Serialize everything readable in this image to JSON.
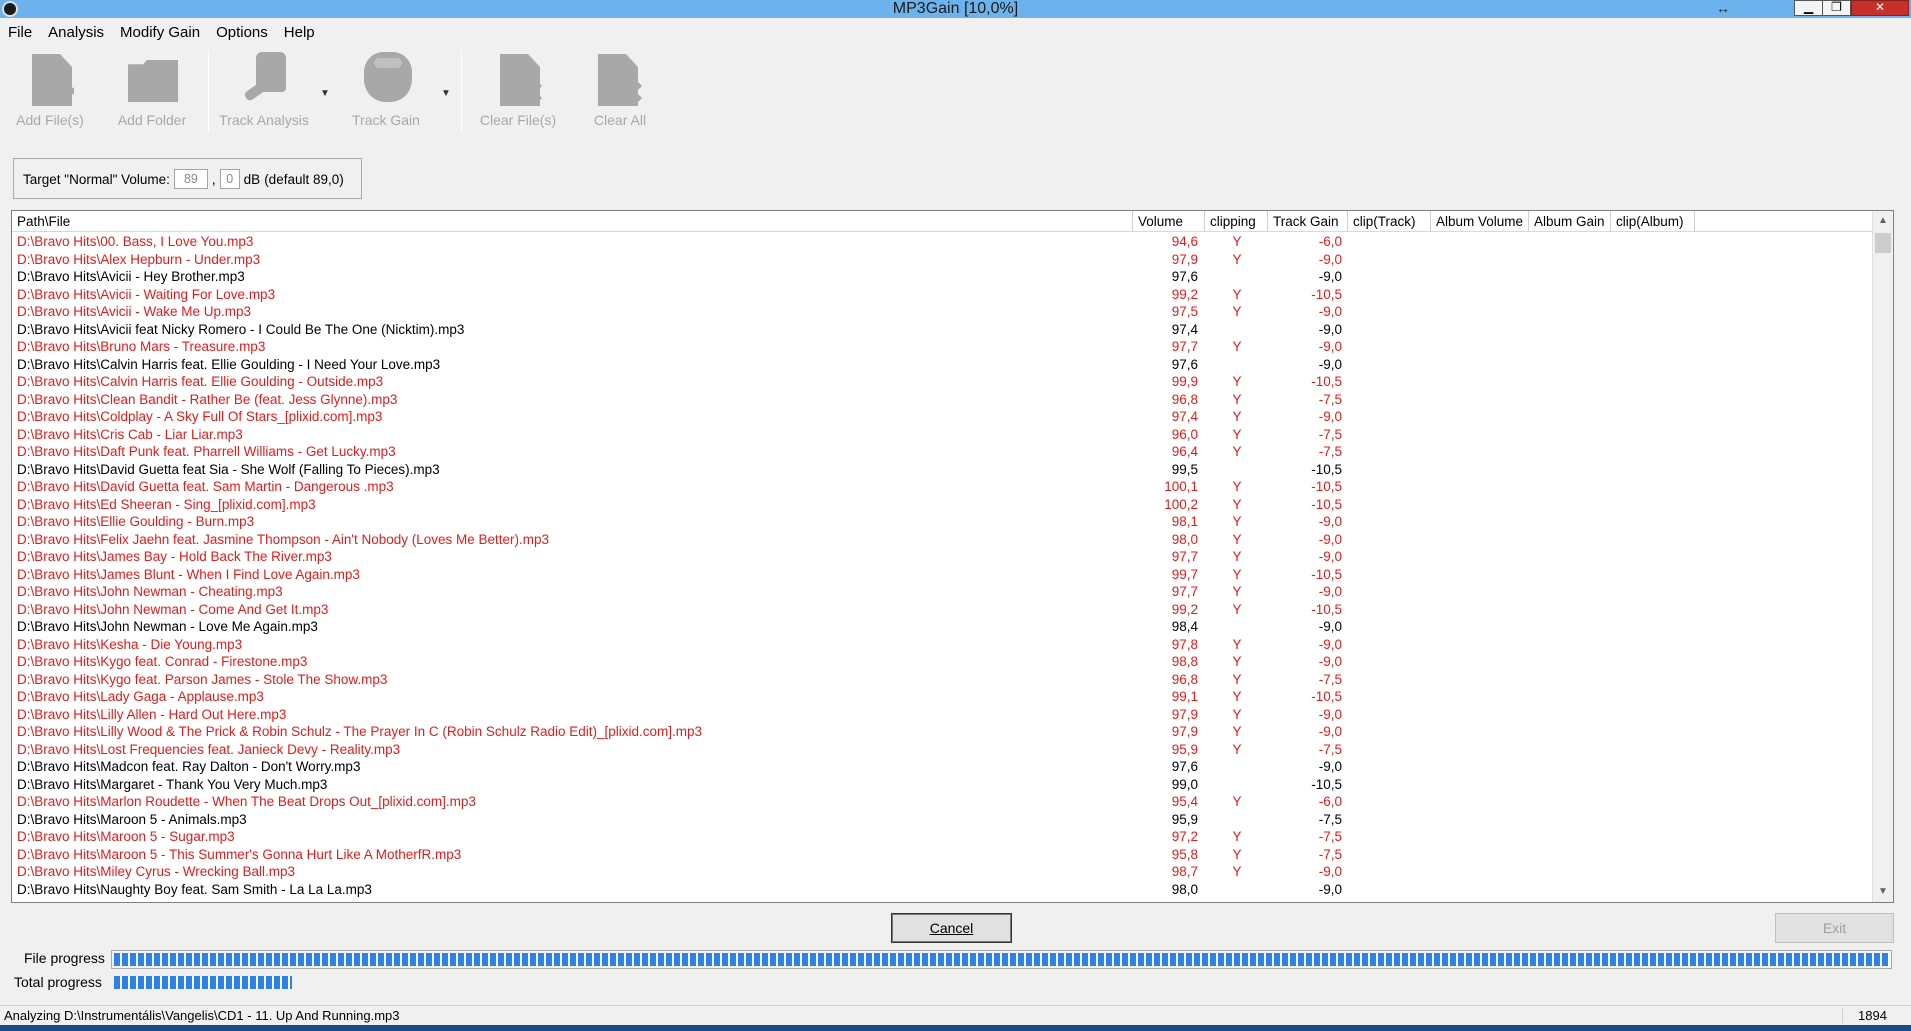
{
  "window": {
    "title": "MP3Gain [10,0%]",
    "resize_icon": "↔",
    "min_icon": "▁",
    "max_icon": "❐",
    "close_icon": "✕"
  },
  "menu": [
    "File",
    "Analysis",
    "Modify Gain",
    "Options",
    "Help"
  ],
  "toolbar": {
    "add_files": "Add File(s)",
    "add_folder": "Add Folder",
    "track_analysis": "Track Analysis",
    "track_gain": "Track Gain",
    "clear_files": "Clear File(s)",
    "clear_all": "Clear All",
    "dropdown_glyph": "▼"
  },
  "target": {
    "label": "Target \"Normal\" Volume:",
    "int_value": "89",
    "comma": ",",
    "dec_value": "0",
    "unit": "dB",
    "default_text": "(default 89,0)"
  },
  "columns": [
    "Path\\File",
    "Volume",
    "clipping",
    "Track Gain",
    "clip(Track)",
    "Album Volume",
    "Album Gain",
    "clip(Album)"
  ],
  "files": [
    {
      "path": "D:\\Bravo Hits\\00. Bass, I Love You.mp3",
      "volume": "94,6",
      "clipping": "Y",
      "gain": "-6,0",
      "red": true
    },
    {
      "path": "D:\\Bravo Hits\\Alex Hepburn - Under.mp3",
      "volume": "97,9",
      "clipping": "Y",
      "gain": "-9,0",
      "red": true
    },
    {
      "path": "D:\\Bravo Hits\\Avicii - Hey Brother.mp3",
      "volume": "97,6",
      "clipping": "",
      "gain": "-9,0",
      "red": false
    },
    {
      "path": "D:\\Bravo Hits\\Avicii - Waiting For Love.mp3",
      "volume": "99,2",
      "clipping": "Y",
      "gain": "-10,5",
      "red": true
    },
    {
      "path": "D:\\Bravo Hits\\Avicii - Wake Me Up.mp3",
      "volume": "97,5",
      "clipping": "Y",
      "gain": "-9,0",
      "red": true
    },
    {
      "path": "D:\\Bravo Hits\\Avicii feat Nicky Romero - I Could Be The One (Nicktim).mp3",
      "volume": "97,4",
      "clipping": "",
      "gain": "-9,0",
      "red": false
    },
    {
      "path": "D:\\Bravo Hits\\Bruno Mars - Treasure.mp3",
      "volume": "97,7",
      "clipping": "Y",
      "gain": "-9,0",
      "red": true
    },
    {
      "path": "D:\\Bravo Hits\\Calvin Harris feat. Ellie Goulding - I Need Your Love.mp3",
      "volume": "97,6",
      "clipping": "",
      "gain": "-9,0",
      "red": false
    },
    {
      "path": "D:\\Bravo Hits\\Calvin Harris feat. Ellie Goulding - Outside.mp3",
      "volume": "99,9",
      "clipping": "Y",
      "gain": "-10,5",
      "red": true
    },
    {
      "path": "D:\\Bravo Hits\\Clean Bandit - Rather Be (feat. Jess Glynne).mp3",
      "volume": "96,8",
      "clipping": "Y",
      "gain": "-7,5",
      "red": true
    },
    {
      "path": "D:\\Bravo Hits\\Coldplay - A Sky Full Of Stars_[plixid.com].mp3",
      "volume": "97,4",
      "clipping": "Y",
      "gain": "-9,0",
      "red": true
    },
    {
      "path": "D:\\Bravo Hits\\Cris Cab - Liar Liar.mp3",
      "volume": "96,0",
      "clipping": "Y",
      "gain": "-7,5",
      "red": true
    },
    {
      "path": "D:\\Bravo Hits\\Daft Punk feat. Pharrell Williams - Get Lucky.mp3",
      "volume": "96,4",
      "clipping": "Y",
      "gain": "-7,5",
      "red": true
    },
    {
      "path": "D:\\Bravo Hits\\David Guetta feat Sia - She Wolf (Falling To Pieces).mp3",
      "volume": "99,5",
      "clipping": "",
      "gain": "-10,5",
      "red": false
    },
    {
      "path": "D:\\Bravo Hits\\David Guetta feat. Sam Martin - Dangerous .mp3",
      "volume": "100,1",
      "clipping": "Y",
      "gain": "-10,5",
      "red": true
    },
    {
      "path": "D:\\Bravo Hits\\Ed Sheeran - Sing_[plixid.com].mp3",
      "volume": "100,2",
      "clipping": "Y",
      "gain": "-10,5",
      "red": true
    },
    {
      "path": "D:\\Bravo Hits\\Ellie Goulding - Burn.mp3",
      "volume": "98,1",
      "clipping": "Y",
      "gain": "-9,0",
      "red": true
    },
    {
      "path": "D:\\Bravo Hits\\Felix Jaehn feat. Jasmine Thompson - Ain't Nobody (Loves Me Better).mp3",
      "volume": "98,0",
      "clipping": "Y",
      "gain": "-9,0",
      "red": true
    },
    {
      "path": "D:\\Bravo Hits\\James Bay - Hold Back The River.mp3",
      "volume": "97,7",
      "clipping": "Y",
      "gain": "-9,0",
      "red": true
    },
    {
      "path": "D:\\Bravo Hits\\James Blunt - When I Find Love Again.mp3",
      "volume": "99,7",
      "clipping": "Y",
      "gain": "-10,5",
      "red": true
    },
    {
      "path": "D:\\Bravo Hits\\John Newman - Cheating.mp3",
      "volume": "97,7",
      "clipping": "Y",
      "gain": "-9,0",
      "red": true
    },
    {
      "path": "D:\\Bravo Hits\\John Newman - Come And Get It.mp3",
      "volume": "99,2",
      "clipping": "Y",
      "gain": "-10,5",
      "red": true
    },
    {
      "path": "D:\\Bravo Hits\\John Newman - Love Me Again.mp3",
      "volume": "98,4",
      "clipping": "",
      "gain": "-9,0",
      "red": false
    },
    {
      "path": "D:\\Bravo Hits\\Kesha - Die Young.mp3",
      "volume": "97,8",
      "clipping": "Y",
      "gain": "-9,0",
      "red": true
    },
    {
      "path": "D:\\Bravo Hits\\Kygo feat. Conrad - Firestone.mp3",
      "volume": "98,8",
      "clipping": "Y",
      "gain": "-9,0",
      "red": true
    },
    {
      "path": "D:\\Bravo Hits\\Kygo feat. Parson James - Stole The Show.mp3",
      "volume": "96,8",
      "clipping": "Y",
      "gain": "-7,5",
      "red": true
    },
    {
      "path": "D:\\Bravo Hits\\Lady Gaga - Applause.mp3",
      "volume": "99,1",
      "clipping": "Y",
      "gain": "-10,5",
      "red": true
    },
    {
      "path": "D:\\Bravo Hits\\Lilly Allen - Hard Out Here.mp3",
      "volume": "97,9",
      "clipping": "Y",
      "gain": "-9,0",
      "red": true
    },
    {
      "path": "D:\\Bravo Hits\\Lilly Wood & The Prick & Robin Schulz - The Prayer In C (Robin Schulz Radio Edit)_[plixid.com].mp3",
      "volume": "97,9",
      "clipping": "Y",
      "gain": "-9,0",
      "red": true
    },
    {
      "path": "D:\\Bravo Hits\\Lost Frequencies feat. Janieck Devy - Reality.mp3",
      "volume": "95,9",
      "clipping": "Y",
      "gain": "-7,5",
      "red": true
    },
    {
      "path": "D:\\Bravo Hits\\Madcon feat. Ray Dalton - Don't Worry.mp3",
      "volume": "97,6",
      "clipping": "",
      "gain": "-9,0",
      "red": false
    },
    {
      "path": "D:\\Bravo Hits\\Margaret - Thank You Very Much.mp3",
      "volume": "99,0",
      "clipping": "",
      "gain": "-10,5",
      "red": false
    },
    {
      "path": "D:\\Bravo Hits\\Marlon Roudette - When The Beat Drops Out_[plixid.com].mp3",
      "volume": "95,4",
      "clipping": "Y",
      "gain": "-6,0",
      "red": true
    },
    {
      "path": "D:\\Bravo Hits\\Maroon 5 - Animals.mp3",
      "volume": "95,9",
      "clipping": "",
      "gain": "-7,5",
      "red": false
    },
    {
      "path": "D:\\Bravo Hits\\Maroon 5 - Sugar.mp3",
      "volume": "97,2",
      "clipping": "Y",
      "gain": "-7,5",
      "red": true
    },
    {
      "path": "D:\\Bravo Hits\\Maroon 5 - This Summer's Gonna Hurt Like A MotherfR.mp3",
      "volume": "95,8",
      "clipping": "Y",
      "gain": "-7,5",
      "red": true
    },
    {
      "path": "D:\\Bravo Hits\\Miley Cyrus - Wrecking Ball.mp3",
      "volume": "98,7",
      "clipping": "Y",
      "gain": "-9,0",
      "red": true
    },
    {
      "path": "D:\\Bravo Hits\\Naughty Boy feat. Sam Smith - La La La.mp3",
      "volume": "98,0",
      "clipping": "",
      "gain": "-9,0",
      "red": false
    }
  ],
  "buttons": {
    "cancel": "Cancel",
    "exit": "Exit"
  },
  "progress": {
    "file_label": "File progress",
    "total_label": "Total progress",
    "file_percent": 100,
    "total_percent": 10
  },
  "status": {
    "text": "Analyzing D:\\Instrumentális\\Vangelis\\CD1 - 11. Up And Running.mp3",
    "count": "1894"
  },
  "colors": {
    "clipping_red": "#e01c1c",
    "title_bar": "#6cb2ec",
    "progress_blue": "#2e82e6"
  }
}
